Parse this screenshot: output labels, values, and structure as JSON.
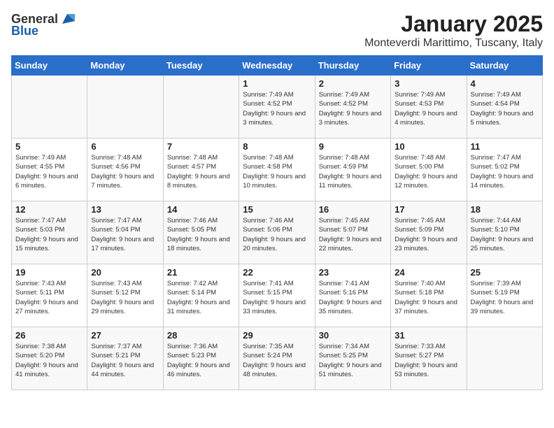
{
  "header": {
    "logo_general": "General",
    "logo_blue": "Blue",
    "month": "January 2025",
    "location": "Monteverdi Marittimo, Tuscany, Italy"
  },
  "weekdays": [
    "Sunday",
    "Monday",
    "Tuesday",
    "Wednesday",
    "Thursday",
    "Friday",
    "Saturday"
  ],
  "weeks": [
    [
      {
        "day": "",
        "info": ""
      },
      {
        "day": "",
        "info": ""
      },
      {
        "day": "",
        "info": ""
      },
      {
        "day": "1",
        "info": "Sunrise: 7:49 AM\nSunset: 4:52 PM\nDaylight: 9 hours and 3 minutes."
      },
      {
        "day": "2",
        "info": "Sunrise: 7:49 AM\nSunset: 4:52 PM\nDaylight: 9 hours and 3 minutes."
      },
      {
        "day": "3",
        "info": "Sunrise: 7:49 AM\nSunset: 4:53 PM\nDaylight: 9 hours and 4 minutes."
      },
      {
        "day": "4",
        "info": "Sunrise: 7:49 AM\nSunset: 4:54 PM\nDaylight: 9 hours and 5 minutes."
      }
    ],
    [
      {
        "day": "5",
        "info": "Sunrise: 7:49 AM\nSunset: 4:55 PM\nDaylight: 9 hours and 6 minutes."
      },
      {
        "day": "6",
        "info": "Sunrise: 7:48 AM\nSunset: 4:56 PM\nDaylight: 9 hours and 7 minutes."
      },
      {
        "day": "7",
        "info": "Sunrise: 7:48 AM\nSunset: 4:57 PM\nDaylight: 9 hours and 8 minutes."
      },
      {
        "day": "8",
        "info": "Sunrise: 7:48 AM\nSunset: 4:58 PM\nDaylight: 9 hours and 10 minutes."
      },
      {
        "day": "9",
        "info": "Sunrise: 7:48 AM\nSunset: 4:59 PM\nDaylight: 9 hours and 11 minutes."
      },
      {
        "day": "10",
        "info": "Sunrise: 7:48 AM\nSunset: 5:00 PM\nDaylight: 9 hours and 12 minutes."
      },
      {
        "day": "11",
        "info": "Sunrise: 7:47 AM\nSunset: 5:02 PM\nDaylight: 9 hours and 14 minutes."
      }
    ],
    [
      {
        "day": "12",
        "info": "Sunrise: 7:47 AM\nSunset: 5:03 PM\nDaylight: 9 hours and 15 minutes."
      },
      {
        "day": "13",
        "info": "Sunrise: 7:47 AM\nSunset: 5:04 PM\nDaylight: 9 hours and 17 minutes."
      },
      {
        "day": "14",
        "info": "Sunrise: 7:46 AM\nSunset: 5:05 PM\nDaylight: 9 hours and 18 minutes."
      },
      {
        "day": "15",
        "info": "Sunrise: 7:46 AM\nSunset: 5:06 PM\nDaylight: 9 hours and 20 minutes."
      },
      {
        "day": "16",
        "info": "Sunrise: 7:45 AM\nSunset: 5:07 PM\nDaylight: 9 hours and 22 minutes."
      },
      {
        "day": "17",
        "info": "Sunrise: 7:45 AM\nSunset: 5:09 PM\nDaylight: 9 hours and 23 minutes."
      },
      {
        "day": "18",
        "info": "Sunrise: 7:44 AM\nSunset: 5:10 PM\nDaylight: 9 hours and 25 minutes."
      }
    ],
    [
      {
        "day": "19",
        "info": "Sunrise: 7:43 AM\nSunset: 5:11 PM\nDaylight: 9 hours and 27 minutes."
      },
      {
        "day": "20",
        "info": "Sunrise: 7:43 AM\nSunset: 5:12 PM\nDaylight: 9 hours and 29 minutes."
      },
      {
        "day": "21",
        "info": "Sunrise: 7:42 AM\nSunset: 5:14 PM\nDaylight: 9 hours and 31 minutes."
      },
      {
        "day": "22",
        "info": "Sunrise: 7:41 AM\nSunset: 5:15 PM\nDaylight: 9 hours and 33 minutes."
      },
      {
        "day": "23",
        "info": "Sunrise: 7:41 AM\nSunset: 5:16 PM\nDaylight: 9 hours and 35 minutes."
      },
      {
        "day": "24",
        "info": "Sunrise: 7:40 AM\nSunset: 5:18 PM\nDaylight: 9 hours and 37 minutes."
      },
      {
        "day": "25",
        "info": "Sunrise: 7:39 AM\nSunset: 5:19 PM\nDaylight: 9 hours and 39 minutes."
      }
    ],
    [
      {
        "day": "26",
        "info": "Sunrise: 7:38 AM\nSunset: 5:20 PM\nDaylight: 9 hours and 41 minutes."
      },
      {
        "day": "27",
        "info": "Sunrise: 7:37 AM\nSunset: 5:21 PM\nDaylight: 9 hours and 44 minutes."
      },
      {
        "day": "28",
        "info": "Sunrise: 7:36 AM\nSunset: 5:23 PM\nDaylight: 9 hours and 46 minutes."
      },
      {
        "day": "29",
        "info": "Sunrise: 7:35 AM\nSunset: 5:24 PM\nDaylight: 9 hours and 48 minutes."
      },
      {
        "day": "30",
        "info": "Sunrise: 7:34 AM\nSunset: 5:25 PM\nDaylight: 9 hours and 51 minutes."
      },
      {
        "day": "31",
        "info": "Sunrise: 7:33 AM\nSunset: 5:27 PM\nDaylight: 9 hours and 53 minutes."
      },
      {
        "day": "",
        "info": ""
      }
    ]
  ]
}
